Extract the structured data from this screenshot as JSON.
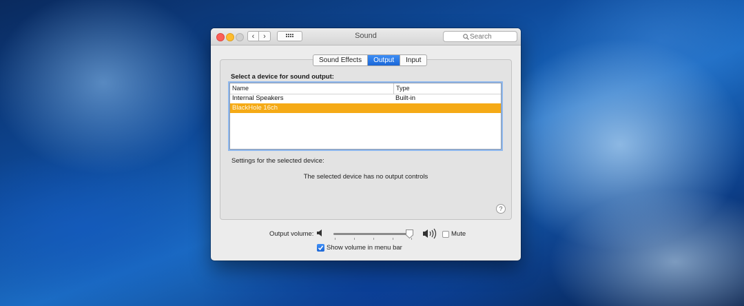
{
  "window": {
    "title": "Sound",
    "nav_back": "‹",
    "nav_forward": "›",
    "search_placeholder": "Search"
  },
  "tabs": [
    {
      "label": "Sound Effects",
      "active": false
    },
    {
      "label": "Output",
      "active": true
    },
    {
      "label": "Input",
      "active": false
    }
  ],
  "output": {
    "section_label": "Select a device for sound output:",
    "columns": [
      "Name",
      "Type"
    ],
    "devices": [
      {
        "name": "Internal Speakers",
        "type": "Built-in",
        "selected": false
      },
      {
        "name": "BlackHole 16ch",
        "type": "",
        "selected": true
      }
    ],
    "settings_label": "Settings for the selected device:",
    "no_controls_text": "The selected device has no output controls",
    "help_label": "?"
  },
  "volume": {
    "label": "Output volume:",
    "level": 0.95,
    "mute_label": "Mute",
    "mute_checked": false,
    "show_in_menu_label": "Show volume in menu bar",
    "show_in_menu_checked": true
  },
  "colors": {
    "accent": "#1a66d6",
    "selection": "#f5aa16",
    "close": "#fc5f57",
    "minimize": "#fdbc2e"
  }
}
